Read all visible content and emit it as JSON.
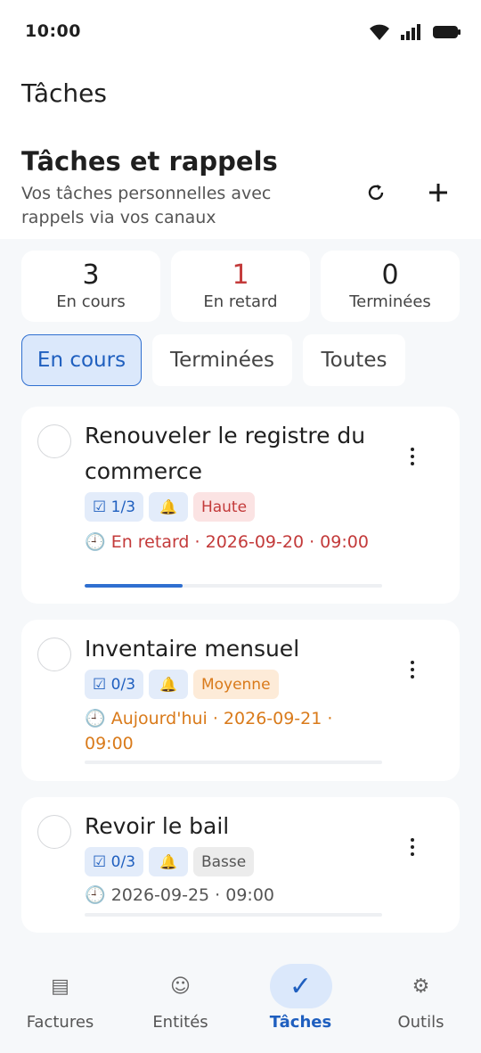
{
  "status_bar": {
    "time": "10:00"
  },
  "app_bar": {
    "title": "Tâches"
  },
  "header": {
    "title": "Tâches et rappels",
    "subtitle": "Vos tâches personnelles avec rappels via vos canaux"
  },
  "stats": [
    {
      "value": "3",
      "label": "En cours",
      "color": "#1f1f1f"
    },
    {
      "value": "1",
      "label": "En retard",
      "color": "#c33a3a"
    },
    {
      "value": "0",
      "label": "Terminées",
      "color": "#1f1f1f"
    }
  ],
  "filters": [
    {
      "label": "En cours",
      "active": true
    },
    {
      "label": "Terminées",
      "active": false
    },
    {
      "label": "Toutes",
      "active": false
    }
  ],
  "tasks": [
    {
      "title": "Renouveler le registre du commerce",
      "subtasks": "☑ 1/3",
      "priority": "Haute",
      "due": "🕘 En retard · 2026-09-20 · 09:00",
      "due_color": "#c33a3a",
      "progress": 0.33
    },
    {
      "title": "Inventaire mensuel",
      "subtasks": "☑ 0/3",
      "priority": "Moyenne",
      "due": "🕘 Aujourd'hui · 2026-09-21 · 09:00",
      "due_color": "#d97a1a",
      "progress": 0
    },
    {
      "title": "Revoir le bail",
      "subtasks": "☑ 0/3",
      "priority": "Basse",
      "due": "🕘 2026-09-25 · 09:00",
      "due_color": "#555555",
      "progress": 0
    }
  ],
  "bottom_nav": [
    {
      "label": "Factures",
      "icon": "invoice-icon",
      "glyph": "▤",
      "active": false
    },
    {
      "label": "Entités",
      "icon": "entities-icon",
      "glyph": "☺",
      "active": false
    },
    {
      "label": "Tâches",
      "icon": "check-icon",
      "glyph": "✓",
      "active": true
    },
    {
      "label": "Outils",
      "icon": "gear-icon",
      "glyph": "⚙",
      "active": false
    }
  ],
  "colors": {
    "accent": "#2f6fd0",
    "danger": "#c33a3a",
    "warning": "#d97a1a"
  }
}
